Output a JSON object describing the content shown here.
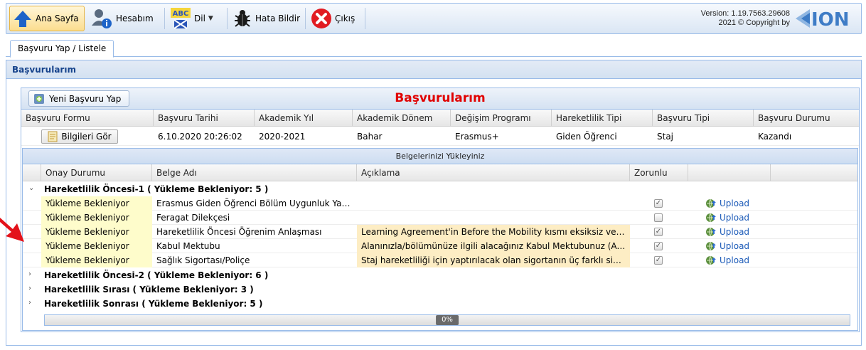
{
  "toolbar": {
    "home_label": "Ana Sayfa",
    "account_label": "Hesabım",
    "lang_badge": "ABC",
    "lang_label": "Dil",
    "bug_label": "Hata Bildir",
    "logout_label": "Çıkış",
    "version_line1": "Version: 1.19.7563.29608",
    "version_line2": "2021 © Copyright by",
    "logo_text": "ION"
  },
  "tab": {
    "label": "Başvuru Yap / Listele"
  },
  "panel": {
    "title": "Başvurularım"
  },
  "grid": {
    "new_button": "Yeni Başvuru Yap",
    "title": "Başvurularım",
    "columns": [
      "Başvuru Formu",
      "Başvuru Tarihi",
      "Akademik Yıl",
      "Akademik Dönem",
      "Değişim Programı",
      "Hareketlilik Tipi",
      "Başvuru Tipi",
      "Başvuru Durumu"
    ],
    "row": {
      "info_button": "Bilgileri Gör",
      "date": "6.10.2020 20:26:02",
      "year": "2020-2021",
      "term": "Bahar",
      "program": "Erasmus+",
      "mobility": "Giden Öğrenci",
      "type": "Staj",
      "status": "Kazandı"
    }
  },
  "docs": {
    "title": "Belgelerinizi Yükleyiniz",
    "columns": [
      "Onay Durumu",
      "Belge Adı",
      "Açıklama",
      "Zorunlu"
    ],
    "groups": [
      "Hareketlilik Öncesi-1 ( Yükleme Bekleniyor: 5 )",
      "Hareketlilik Öncesi-2 ( Yükleme Bekleniyor: 6 )",
      "Hareketlilik Sırası ( Yükleme Bekleniyor: 3 )",
      "Hareketlilik Sonrası ( Yükleme Bekleniyor: 5 )"
    ],
    "rows": [
      {
        "status": "Yükleme Bekleniyor",
        "name": "Erasmus Giden Öğrenci Bölüm Uygunluk Yazısı",
        "desc": "",
        "required": true,
        "upload": "Upload"
      },
      {
        "status": "Yükleme Bekleniyor",
        "name": "Feragat Dilekçesi",
        "desc": "",
        "required": false,
        "upload": "Upload"
      },
      {
        "status": "Yükleme Bekleniyor",
        "name": "Hareketlilik Öncesi Öğrenim Anlaşması",
        "desc": "Learning Agreement'in Before the Mobility kısmı eksiksiz ve do...",
        "required": true,
        "upload": "Upload"
      },
      {
        "status": "Yükleme Bekleniyor",
        "name": "Kabul Mektubu",
        "desc": "Alanınızla/bölümünüze ilgili alacağınız Kabul Mektubunuz (Acc...",
        "required": true,
        "upload": "Upload"
      },
      {
        "status": "Yükleme Bekleniyor",
        "name": "Sağlık Sigortası/Poliçe",
        "desc": "Staj hareketliliği için yaptırılacak olan sigortanın üç farklı sigor...",
        "required": true,
        "upload": "Upload"
      }
    ],
    "progress": "0%"
  },
  "colors": {
    "accent_blue": "#99bbe8",
    "title_red": "#e00000",
    "arrow_red": "#e3121a",
    "status_yellow": "#fefccb",
    "desc_orange": "#fdedc4",
    "link_blue": "#1c5bb8"
  }
}
